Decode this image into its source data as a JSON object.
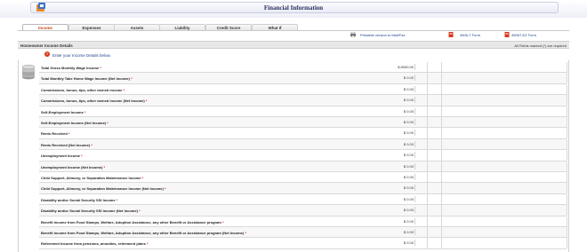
{
  "app": {
    "title": "Financial Information"
  },
  "tabs": [
    {
      "label": "Income",
      "active": true
    },
    {
      "label": "Expenses",
      "active": false
    },
    {
      "label": "Assets",
      "active": false
    },
    {
      "label": "Liability",
      "active": false
    },
    {
      "label": "Credit Score",
      "active": false
    },
    {
      "label": "What If",
      "active": false
    }
  ],
  "links": {
    "printable": "Printable version to Mail/Fax",
    "form_4506t": "4506-T Form",
    "form_4506t_ez": "4506T-EZ Form"
  },
  "section": {
    "title": "Homeowner Income Details",
    "required_note": "All Fields marked (*) are required"
  },
  "hint": "Enter your Income Details below.",
  "required_mark": "*",
  "colors": {
    "accent": "#c04010",
    "link": "#1f3f8f",
    "required": "#cc0000"
  },
  "income_rows": [
    {
      "label": "Total Gross Monthly Wage Income",
      "amount": "$ 8000.00"
    },
    {
      "label": "Total Monthly Take Home Wage Income (Net Income)",
      "amount": "$ 0.00"
    },
    {
      "label": "Commissions, bonus, tips, other earned income",
      "amount": "$ 0.00"
    },
    {
      "label": "Commissions, bonus, tips, other earned income (Net Income)",
      "amount": "$ 0.00"
    },
    {
      "label": "Self-Employment Income",
      "amount": "$ 0.00"
    },
    {
      "label": "Self-Employment Income (Net Income)",
      "amount": "$ 0.00"
    },
    {
      "label": "Rents Received",
      "amount": "$ 0.00"
    },
    {
      "label": "Rents Received (Net Income)",
      "amount": "$ 0.00"
    },
    {
      "label": "Unemployment Income",
      "amount": "$ 0.00"
    },
    {
      "label": "Unemployment Income (Net Income)",
      "amount": "$ 0.00"
    },
    {
      "label": "Child Support, Alimony, or Separation Maintenance Income",
      "amount": "$ 0.00"
    },
    {
      "label": "Child Support, Alimony, or Separation Maintenance Income (Net Income)",
      "amount": "$ 0.00"
    },
    {
      "label": "Disability and/or Social Security SSI Income",
      "amount": "$ 0.00"
    },
    {
      "label": "Disability and/or Social Security SSI Income (Net Income)",
      "amount": "$ 0.00"
    },
    {
      "label": "Benefit Income from Food Stamps, Welfare, Adoption Assistance, any other Benefit or Assistance program",
      "amount": "$ 0.00"
    },
    {
      "label": "Benefit Income from Food Stamps, Welfare, Adoption Assistance, any other Benefit or Assistance program (Net Income)",
      "amount": "$ 0.00"
    },
    {
      "label": "Retirement Income from pensions, annuities, retirement plans",
      "amount": "$ 0.00"
    }
  ]
}
